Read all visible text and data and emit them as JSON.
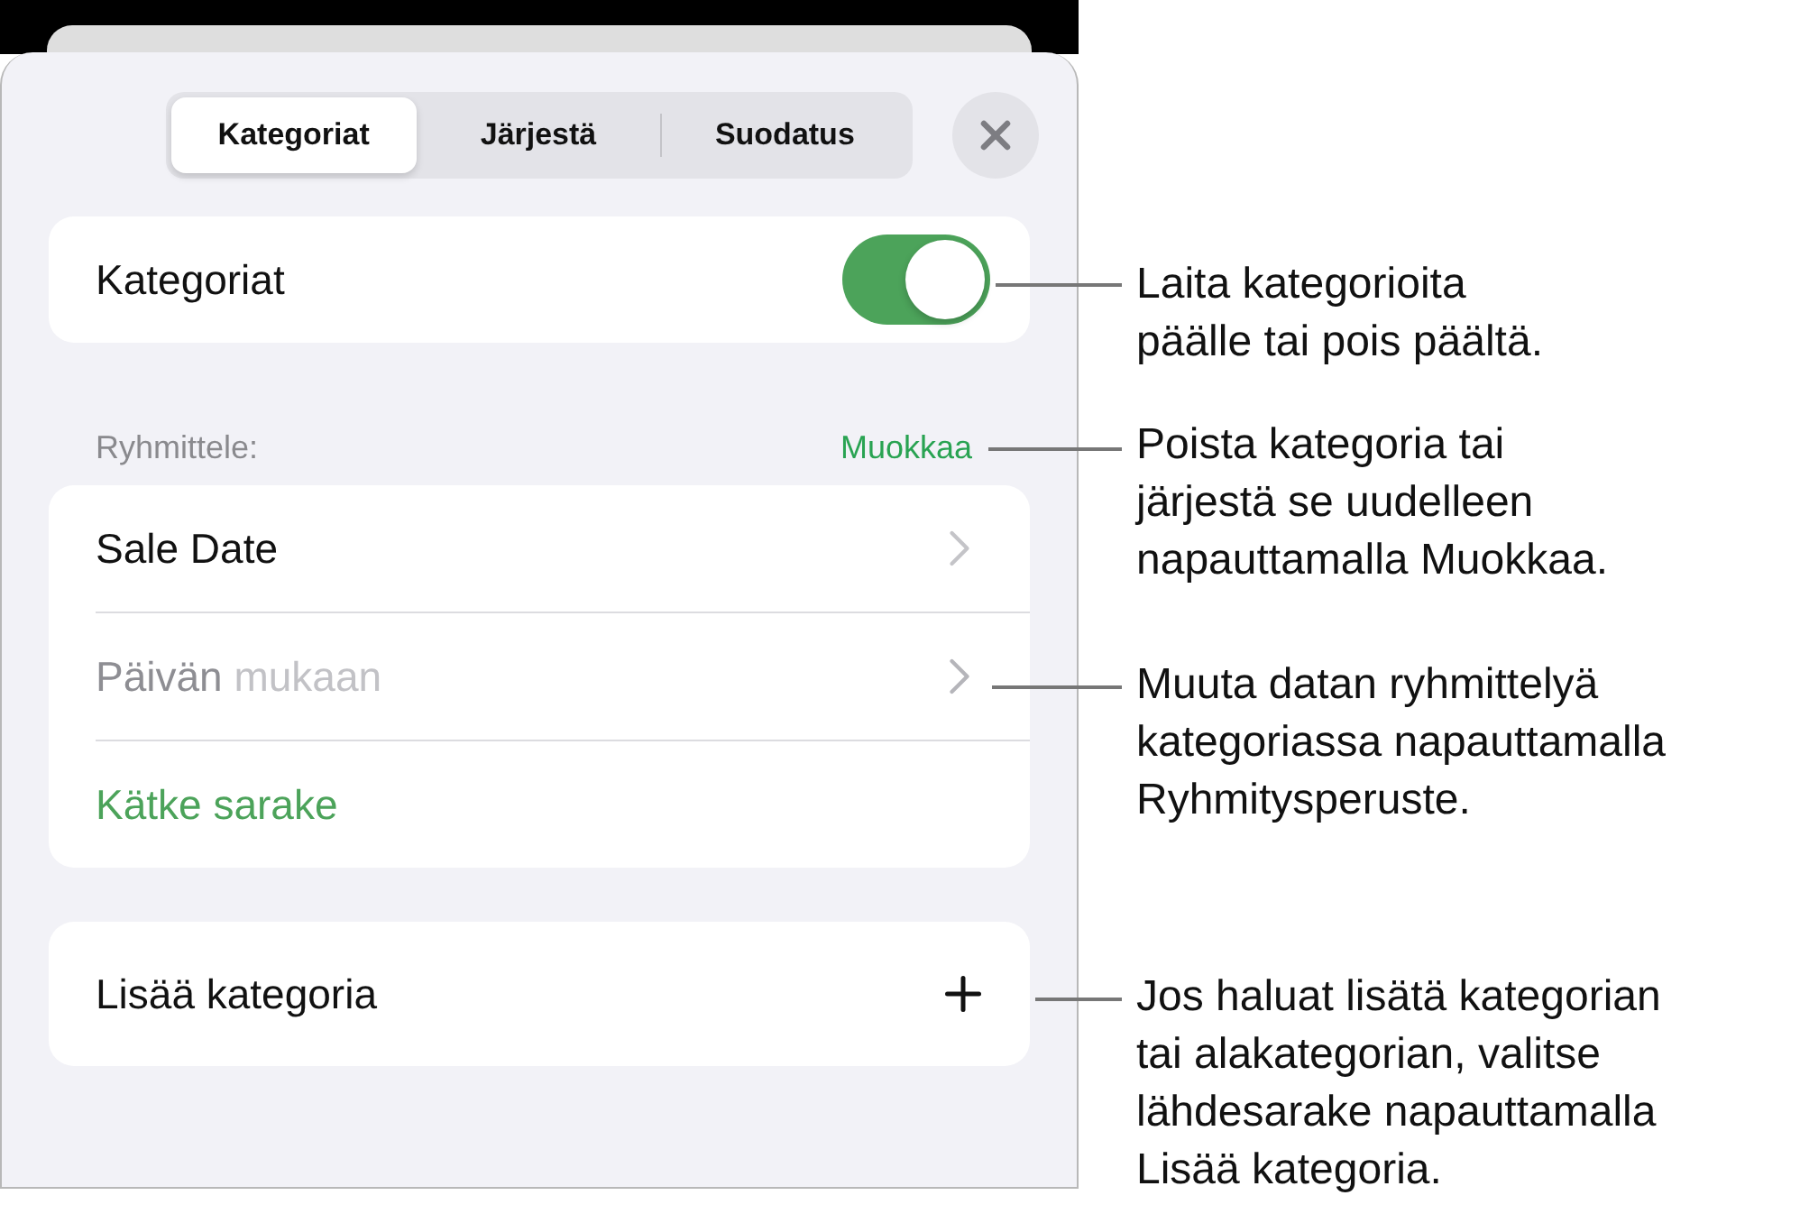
{
  "sheet": {
    "tabs": [
      {
        "label": "Kategoriat",
        "selected": true
      },
      {
        "label": "Järjestä",
        "selected": false
      },
      {
        "label": "Suodatus",
        "selected": false
      }
    ],
    "toggle_row": {
      "label": "Kategoriat",
      "on": true
    },
    "group": {
      "header": "Ryhmittele:",
      "action": "Muokkaa",
      "rows": [
        {
          "kind": "nav",
          "label": "Sale Date"
        },
        {
          "kind": "nav",
          "label": "Päivän",
          "detail": "mukaan",
          "disabled": true
        },
        {
          "kind": "action",
          "label": "Kätke sarake"
        }
      ]
    },
    "add_row": {
      "label": "Lisää kategoria"
    }
  },
  "callouts": [
    {
      "lines": [
        "Laita kategorioita",
        "päälle tai pois päältä."
      ]
    },
    {
      "lines": [
        "Poista kategoria tai",
        "järjestä se uudelleen",
        "napauttamalla Muokkaa."
      ]
    },
    {
      "lines": [
        "Muuta datan ryhmittelyä",
        "kategoriassa napauttamalla",
        "Ryhmitysperuste."
      ]
    },
    {
      "lines": [
        "Jos haluat lisätä kategorian",
        "tai alakategorian, valitse",
        "lähdesarake napauttamalla",
        "Lisää kategoria."
      ]
    }
  ]
}
